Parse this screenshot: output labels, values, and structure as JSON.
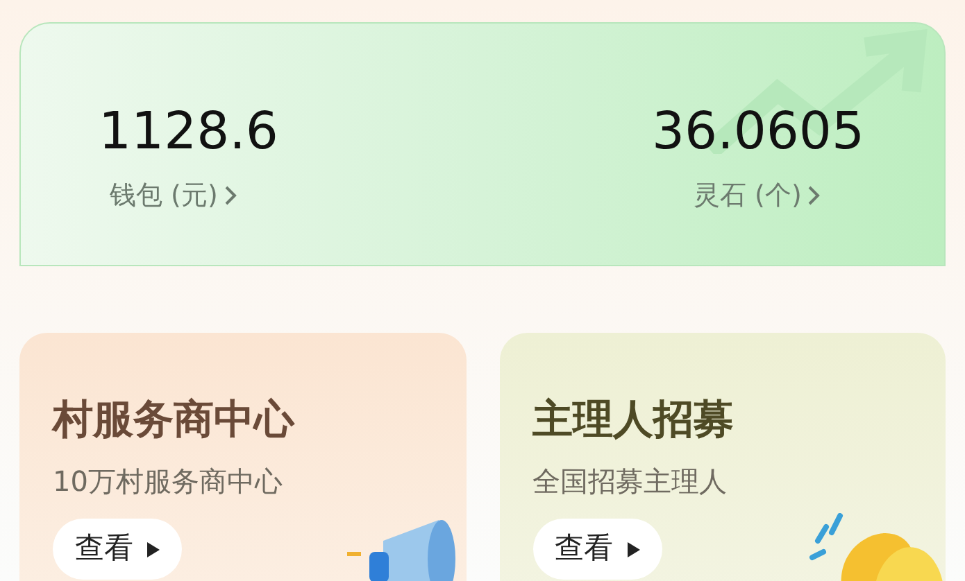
{
  "balance_card": {
    "stats": [
      {
        "value": "1128.6",
        "label": "钱包 (元)"
      },
      {
        "value": "36.0605",
        "label": "灵石 (个)"
      }
    ]
  },
  "promo_cards": [
    {
      "kind": "megaphone",
      "title": "村服务商中心",
      "subtitle": "10万村服务商中心",
      "button": "查看"
    },
    {
      "kind": "clap",
      "title": "主理人招募",
      "subtitle": "全国招募主理人",
      "button": "查看"
    }
  ]
}
